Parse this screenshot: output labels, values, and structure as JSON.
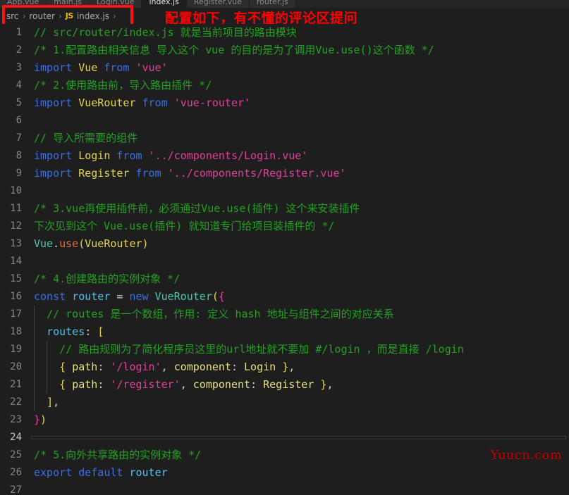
{
  "window": {
    "background_color": "#1e1e1e",
    "tab_bar_color": "#252526"
  },
  "tabs": [
    {
      "label": "App.vue",
      "active": false
    },
    {
      "label": "main.js",
      "active": false
    },
    {
      "label": "Login.vue",
      "active": false
    },
    {
      "label": "index.js",
      "active": true
    },
    {
      "label": "Register.vue",
      "active": false
    },
    {
      "label": "router.js",
      "active": false
    }
  ],
  "breadcrumb": {
    "items": [
      "src",
      "router",
      "index.js"
    ],
    "file_icon_label": "JS",
    "separator": "›",
    "trailing_separator": "›"
  },
  "annotations": {
    "red_text": "配置如下，有不懂的评论区提问",
    "red_text_color": "#ff0000",
    "box_color": "#ff1111",
    "watermark": "Yuucn.com",
    "watermark_color": "#c00000"
  },
  "editor": {
    "active_line": 24,
    "total_visible_lines": 27,
    "lines": [
      {
        "n": 1,
        "tokens": [
          {
            "t": "com",
            "v": "// src/router/index.js 就是当前项目的路由模块"
          }
        ]
      },
      {
        "n": 2,
        "tokens": [
          {
            "t": "com",
            "v": "/* 1.配置路由相关信息 导入这个 vue 的目的是为了调用Vue.use()这个函数 */"
          }
        ]
      },
      {
        "n": 3,
        "tokens": [
          {
            "t": "key",
            "v": "import"
          },
          {
            "t": "plain",
            "v": " "
          },
          {
            "t": "ident",
            "v": "Vue"
          },
          {
            "t": "plain",
            "v": " "
          },
          {
            "t": "from",
            "v": "from"
          },
          {
            "t": "plain",
            "v": " "
          },
          {
            "t": "str",
            "v": "'vue'"
          }
        ]
      },
      {
        "n": 4,
        "tokens": [
          {
            "t": "com",
            "v": "/* 2.使用路由前，导入路由插件 */"
          }
        ]
      },
      {
        "n": 5,
        "tokens": [
          {
            "t": "key",
            "v": "import"
          },
          {
            "t": "plain",
            "v": " "
          },
          {
            "t": "ident",
            "v": "VueRouter"
          },
          {
            "t": "plain",
            "v": " "
          },
          {
            "t": "from",
            "v": "from"
          },
          {
            "t": "plain",
            "v": " "
          },
          {
            "t": "str",
            "v": "'vue-router'"
          }
        ]
      },
      {
        "n": 6,
        "tokens": []
      },
      {
        "n": 7,
        "tokens": [
          {
            "t": "com",
            "v": "// 导入所需要的组件"
          }
        ]
      },
      {
        "n": 8,
        "tokens": [
          {
            "t": "key",
            "v": "import"
          },
          {
            "t": "plain",
            "v": " "
          },
          {
            "t": "ident",
            "v": "Login"
          },
          {
            "t": "plain",
            "v": " "
          },
          {
            "t": "from",
            "v": "from"
          },
          {
            "t": "plain",
            "v": " "
          },
          {
            "t": "str",
            "v": "'../components/Login.vue'"
          }
        ]
      },
      {
        "n": 9,
        "tokens": [
          {
            "t": "key",
            "v": "import"
          },
          {
            "t": "plain",
            "v": " "
          },
          {
            "t": "ident",
            "v": "Register"
          },
          {
            "t": "plain",
            "v": " "
          },
          {
            "t": "from",
            "v": "from"
          },
          {
            "t": "plain",
            "v": " "
          },
          {
            "t": "str",
            "v": "'../components/Register.vue'"
          }
        ]
      },
      {
        "n": 10,
        "tokens": []
      },
      {
        "n": 11,
        "tokens": [
          {
            "t": "com",
            "v": "/* 3.vue再使用插件前，必须通过Vue.use(插件) 这个来安装插件"
          }
        ]
      },
      {
        "n": 12,
        "tokens": [
          {
            "t": "com",
            "v": "下次见到这个 Vue.use(插件) 就知道专门给项目装插件的 */"
          }
        ]
      },
      {
        "n": 13,
        "tokens": [
          {
            "t": "fn",
            "v": "Vue"
          },
          {
            "t": "punct",
            "v": "."
          },
          {
            "t": "meth",
            "v": "use"
          },
          {
            "t": "paren",
            "v": "("
          },
          {
            "t": "ident",
            "v": "VueRouter"
          },
          {
            "t": "paren",
            "v": ")"
          }
        ]
      },
      {
        "n": 14,
        "tokens": []
      },
      {
        "n": 15,
        "tokens": [
          {
            "t": "com",
            "v": "/* 4.创建路由的实例对象 */"
          }
        ]
      },
      {
        "n": 16,
        "tokens": [
          {
            "t": "key",
            "v": "const"
          },
          {
            "t": "plain",
            "v": " "
          },
          {
            "t": "var",
            "v": "router"
          },
          {
            "t": "plain",
            "v": " "
          },
          {
            "t": "punct",
            "v": "="
          },
          {
            "t": "plain",
            "v": " "
          },
          {
            "t": "key",
            "v": "new"
          },
          {
            "t": "plain",
            "v": " "
          },
          {
            "t": "fn",
            "v": "VueRouter"
          },
          {
            "t": "paren",
            "v": "("
          },
          {
            "t": "brace",
            "v": "{"
          }
        ]
      },
      {
        "n": 17,
        "indent": 1,
        "tokens": [
          {
            "t": "com",
            "v": "  // routes 是一个数组，作用: 定义 hash 地址与组件之间的对应关系"
          }
        ]
      },
      {
        "n": 18,
        "indent": 1,
        "tokens": [
          {
            "t": "plain",
            "v": "  "
          },
          {
            "t": "var",
            "v": "routes"
          },
          {
            "t": "punct",
            "v": ":"
          },
          {
            "t": "plain",
            "v": " "
          },
          {
            "t": "paren",
            "v": "["
          }
        ]
      },
      {
        "n": 19,
        "indent": 2,
        "tokens": [
          {
            "t": "com",
            "v": "    // 路由规则为了简化程序员这里的url地址就不要加 #/login ，而是直接 /login"
          }
        ]
      },
      {
        "n": 20,
        "indent": 2,
        "tokens": [
          {
            "t": "plain",
            "v": "    "
          },
          {
            "t": "paren",
            "v": "{"
          },
          {
            "t": "plain",
            "v": " "
          },
          {
            "t": "prop",
            "v": "path"
          },
          {
            "t": "punct",
            "v": ":"
          },
          {
            "t": "plain",
            "v": " "
          },
          {
            "t": "str",
            "v": "'/login'"
          },
          {
            "t": "punct",
            "v": ","
          },
          {
            "t": "plain",
            "v": " "
          },
          {
            "t": "prop",
            "v": "component"
          },
          {
            "t": "punct",
            "v": ":"
          },
          {
            "t": "plain",
            "v": " "
          },
          {
            "t": "prop",
            "v": "Login"
          },
          {
            "t": "plain",
            "v": " "
          },
          {
            "t": "paren",
            "v": "}"
          },
          {
            "t": "punct",
            "v": ","
          }
        ]
      },
      {
        "n": 21,
        "indent": 2,
        "tokens": [
          {
            "t": "plain",
            "v": "    "
          },
          {
            "t": "paren",
            "v": "{"
          },
          {
            "t": "plain",
            "v": " "
          },
          {
            "t": "prop",
            "v": "path"
          },
          {
            "t": "punct",
            "v": ":"
          },
          {
            "t": "plain",
            "v": " "
          },
          {
            "t": "str",
            "v": "'/register'"
          },
          {
            "t": "punct",
            "v": ","
          },
          {
            "t": "plain",
            "v": " "
          },
          {
            "t": "prop",
            "v": "component"
          },
          {
            "t": "punct",
            "v": ":"
          },
          {
            "t": "plain",
            "v": " "
          },
          {
            "t": "prop",
            "v": "Register"
          },
          {
            "t": "plain",
            "v": " "
          },
          {
            "t": "paren",
            "v": "}"
          },
          {
            "t": "punct",
            "v": ","
          }
        ]
      },
      {
        "n": 22,
        "indent": 1,
        "tokens": [
          {
            "t": "plain",
            "v": "  "
          },
          {
            "t": "paren",
            "v": "]"
          },
          {
            "t": "punct",
            "v": ","
          }
        ]
      },
      {
        "n": 23,
        "tokens": [
          {
            "t": "brace",
            "v": "}"
          },
          {
            "t": "paren",
            "v": ")"
          }
        ]
      },
      {
        "n": 24,
        "tokens": []
      },
      {
        "n": 25,
        "tokens": [
          {
            "t": "com",
            "v": "/* 5.向外共享路由的实例对象 */"
          }
        ]
      },
      {
        "n": 26,
        "tokens": [
          {
            "t": "key",
            "v": "export"
          },
          {
            "t": "plain",
            "v": " "
          },
          {
            "t": "key",
            "v": "default"
          },
          {
            "t": "plain",
            "v": " "
          },
          {
            "t": "var",
            "v": "router"
          }
        ]
      },
      {
        "n": 27,
        "tokens": []
      }
    ]
  }
}
